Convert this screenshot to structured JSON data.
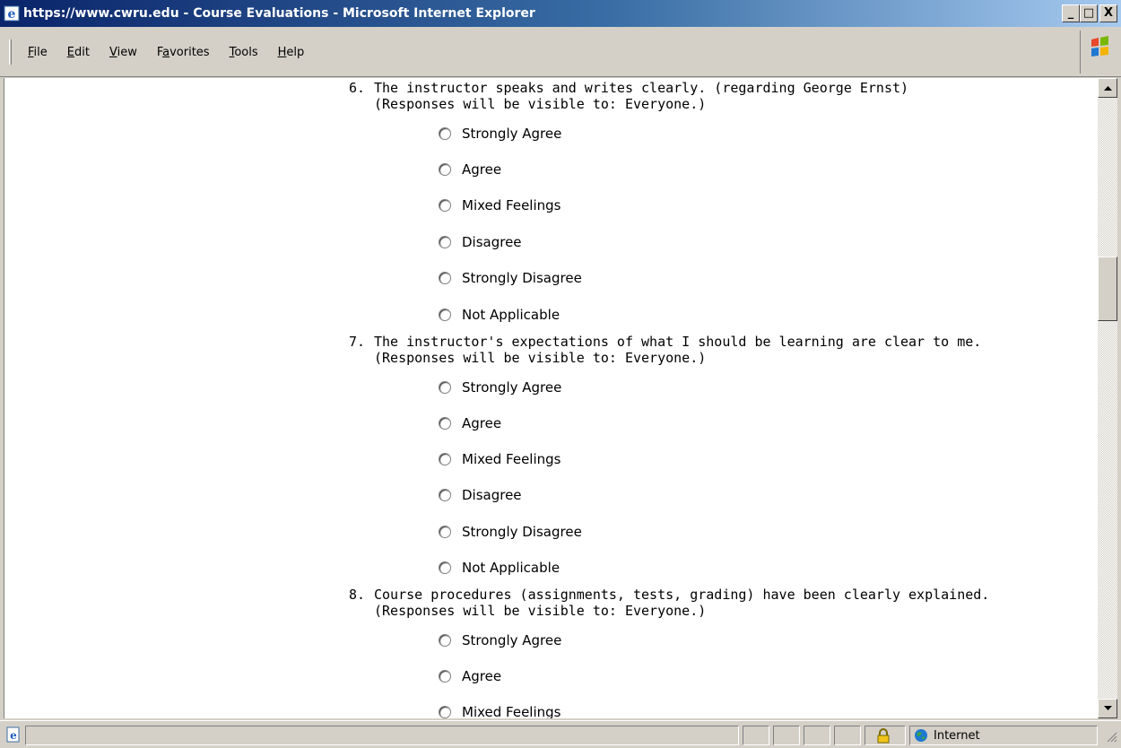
{
  "window": {
    "title": "https://www.cwru.edu - Course Evaluations - Microsoft Internet Explorer",
    "buttons": {
      "minimize": "_",
      "maximize": "□",
      "close": "X"
    }
  },
  "menu": {
    "items": [
      {
        "label": "File",
        "accel": "F",
        "rest": "ile"
      },
      {
        "label": "Edit",
        "accel": "E",
        "rest": "dit"
      },
      {
        "label": "View",
        "accel": "V",
        "rest": "iew"
      },
      {
        "label": "Favorites",
        "accel_pre": "F",
        "accel": "a",
        "rest": "vorites"
      },
      {
        "label": "Tools",
        "accel": "T",
        "rest": "ools"
      },
      {
        "label": "Help",
        "accel": "H",
        "rest": "elp"
      }
    ]
  },
  "questions": [
    {
      "number": "6.",
      "text": "The instructor speaks and writes clearly. (regarding George Ernst)",
      "visibility": "(Responses will be visible to: Everyone.)",
      "options": [
        "Strongly Agree",
        "Agree",
        "Mixed Feelings",
        "Disagree",
        "Strongly Disagree",
        "Not Applicable"
      ]
    },
    {
      "number": "7.",
      "text": "The instructor's expectations of what I should be learning are clear to me.",
      "visibility": "(Responses will be visible to: Everyone.)",
      "options": [
        "Strongly Agree",
        "Agree",
        "Mixed Feelings",
        "Disagree",
        "Strongly Disagree",
        "Not Applicable"
      ]
    },
    {
      "number": "8.",
      "text": "Course procedures (assignments, tests, grading) have been clearly explained.",
      "visibility": "(Responses will be visible to: Everyone.)",
      "options": [
        "Strongly Agree",
        "Agree",
        "Mixed Feelings"
      ]
    }
  ],
  "status": {
    "zone": "Internet"
  },
  "icons": {
    "title": "ie-icon",
    "status_page": "ie-page-icon",
    "lock": "lock-icon",
    "zone": "globe-icon",
    "logo": "windows-logo"
  },
  "colors": {
    "titlebar_start": "#0a246a",
    "titlebar_end": "#a6caf0",
    "chrome": "#d4d0c8",
    "content_bg": "#ffffff"
  }
}
